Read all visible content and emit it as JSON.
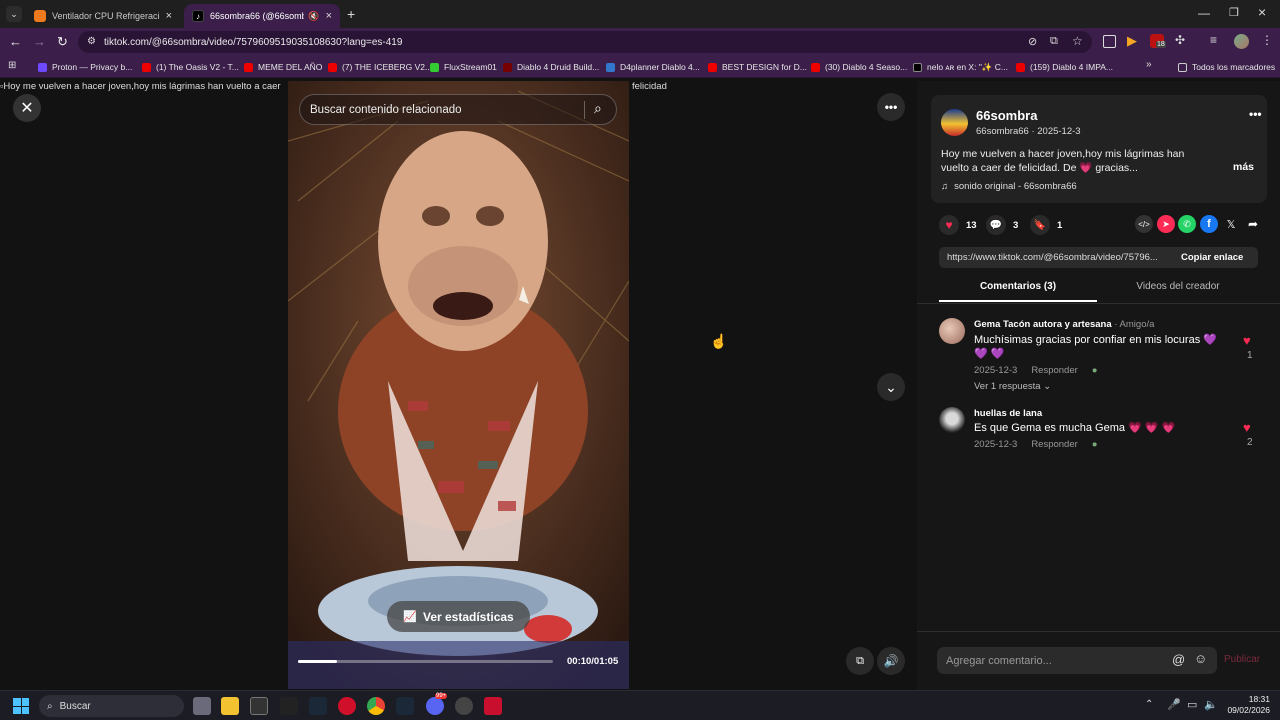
{
  "browser": {
    "tabs": [
      {
        "label": "Ventilador CPU Refrigeración A",
        "active": false
      },
      {
        "label": "66sombra66 (@66sombra) |",
        "active": true
      }
    ],
    "url": "tiktok.com/@66sombra/video/7579609519035108630?lang=es-419",
    "bookmarks": [
      "Proton — Privacy b...",
      "(1) The Oasis V2 - T...",
      "MEME DEL AÑO",
      "(7) THE ICEBERG V2...",
      "FluxStream01",
      "Diablo 4 Druid Build...",
      "D4planner Diablo 4...",
      "BEST DESIGN for D...",
      "(30) Diablo 4 Seaso...",
      "nelo ᴀʀ en X: \"✨ C...",
      "(159) Diablo 4 IMPA..."
    ],
    "all_bookmarks_label": "Todos los marcadores",
    "extension_badge": "18"
  },
  "viewer": {
    "alt_text_left": "Hoy me vuelven a hacer joven,hoy mis lágrimas han vuelto a caer",
    "alt_text_right": "felicidad",
    "search_placeholder": "Buscar contenido relacionado",
    "stats_button": "Ver estadísticas",
    "time": "00:10/01:05",
    "progress": 0.154
  },
  "post": {
    "author": "66sombra",
    "handle_date": "66sombra66 · 2025-12-3",
    "description": "Hoy me vuelven a hacer joven,hoy mis lágrimas han vuelto a caer de felicidad. De 💗 gracias...",
    "more_label": "más",
    "sound": "sonido original - 66sombra66",
    "likes": "13",
    "comments": "3",
    "saves": "1",
    "share_url": "https://www.tiktok.com/@66sombra/video/75796...",
    "copy_link_label": "Copiar enlace",
    "tabs": [
      "Comentarios (3)",
      "Videos del creador"
    ]
  },
  "comments": [
    {
      "user": "Gema Tacón autora y artesana",
      "tag": "· Amigo/a",
      "text": "Muchísimas gracias por confiar en mis locuras 💜 💜 💜",
      "date": "2025-12-3",
      "reply": "Responder",
      "likes": "1",
      "view_replies": "Ver 1 respuesta"
    },
    {
      "user": "huellas de lana",
      "tag": "",
      "text": "Es que Gema es mucha Gema 💗 💗 💗",
      "date": "2025-12-3",
      "reply": "Responder",
      "likes": "2",
      "view_replies": ""
    }
  ],
  "composer": {
    "placeholder": "Agregar comentario...",
    "publish": "Publicar"
  },
  "taskbar": {
    "search_label": "Buscar",
    "time": "18:31",
    "date": "09/02/2026",
    "discord_badge": "99+"
  },
  "colors": {
    "accent": "#fe2c55",
    "browser_chrome": "#3b1f4a",
    "background": "#121212"
  }
}
